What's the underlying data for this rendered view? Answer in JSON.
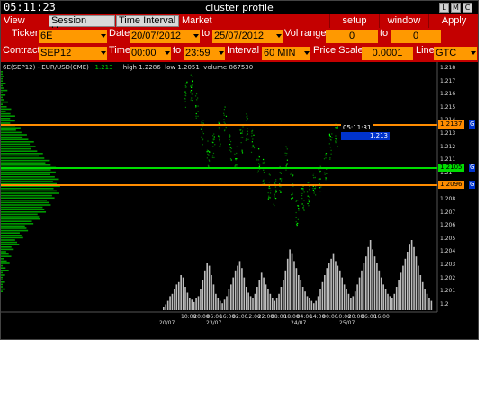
{
  "window": {
    "clock": "05:11:23",
    "title": "cluster profile",
    "buttons": [
      "L",
      "M",
      "C"
    ]
  },
  "menu": {
    "tabs": [
      "View DOM",
      "Session Hours",
      "Time Interval",
      "Market Watch"
    ],
    "actions": [
      "setup",
      "window",
      "Apply"
    ]
  },
  "controls": {
    "ticker_label": "Ticker",
    "ticker": "6E",
    "date_label": "Date",
    "date_from": "20/07/2012",
    "to_label": "to",
    "date_to": "25/07/2012",
    "vol_range_label": "Vol range",
    "vol_from": "0",
    "vol_to_label": "to",
    "vol_to": "0",
    "contract_label": "Contract",
    "contract": "SEP12",
    "time_label": "Time",
    "time_from": "00:00",
    "time_to_label": "to",
    "time_to": "23:59",
    "interval_label": "Interval",
    "interval": "60 MIN",
    "price_scale_label": "Price Scale",
    "price_scale": "0.0001",
    "line_label": "Line",
    "line": "GTC"
  },
  "chart": {
    "symbol": "6E(SEP12) - EUR/USD(CME)",
    "last": "1.213",
    "high_text": "high 1.2286",
    "low_text": "low 1.2051",
    "volume_text": "volume 867530",
    "time_tag": "05:11:31",
    "price_tag": "1.213",
    "line_tags": [
      "1.2137",
      "1.2105",
      "1.2096"
    ],
    "g_markers": [
      "G",
      "G",
      "G"
    ],
    "colors": {
      "bg": "#000000",
      "accent": "#c40000",
      "field": "#ff9900",
      "green": "#00dd00",
      "orange": "#ff8c00",
      "blue": "#0033cc"
    }
  },
  "chart_data": {
    "type": "bar",
    "y_ticks": [
      "1.218",
      "1.217",
      "1.216",
      "1.215",
      "1.214",
      "1.213",
      "1.212",
      "1.211",
      "1.21",
      "1.209",
      "1.208",
      "1.207",
      "1.206",
      "1.205",
      "1.204",
      "1.203",
      "1.202",
      "1.201",
      "1.2"
    ],
    "x_tick_times": [
      "10:00",
      "20:00",
      "06:00",
      "16:00",
      "02:00",
      "12:00",
      "22:00",
      "08:00",
      "18:00",
      "04:00",
      "14:00",
      "00:00",
      "10:00",
      "20:00",
      "06:00",
      "16:00"
    ],
    "x_tick_dates": [
      "20/07",
      "23/07",
      "24/07",
      "25/07"
    ],
    "price_lines": [
      1.2137,
      1.2105,
      1.2096
    ],
    "volume_bars": [
      3,
      5,
      8,
      12,
      14,
      18,
      22,
      24,
      30,
      28,
      20,
      15,
      10,
      9,
      7,
      10,
      12,
      18,
      26,
      34,
      40,
      38,
      30,
      22,
      14,
      10,
      8,
      6,
      9,
      12,
      18,
      22,
      28,
      34,
      38,
      42,
      36,
      28,
      20,
      15,
      12,
      10,
      14,
      20,
      26,
      32,
      28,
      22,
      18,
      14,
      10,
      8,
      10,
      14,
      20,
      26,
      34,
      44,
      52,
      48,
      42,
      36,
      30,
      26,
      20,
      16,
      12,
      10,
      8,
      6,
      8,
      12,
      18,
      24,
      30,
      36,
      40,
      44,
      48,
      42,
      38,
      34,
      28,
      22,
      18,
      14,
      10,
      12,
      16,
      22,
      28,
      34,
      40,
      46,
      54,
      60,
      52,
      46,
      40,
      34,
      28,
      22,
      18,
      14,
      12,
      10,
      14,
      20,
      26,
      32,
      38,
      44,
      50,
      56,
      60,
      54,
      46,
      38,
      30,
      24,
      18,
      14,
      10,
      8
    ]
  }
}
